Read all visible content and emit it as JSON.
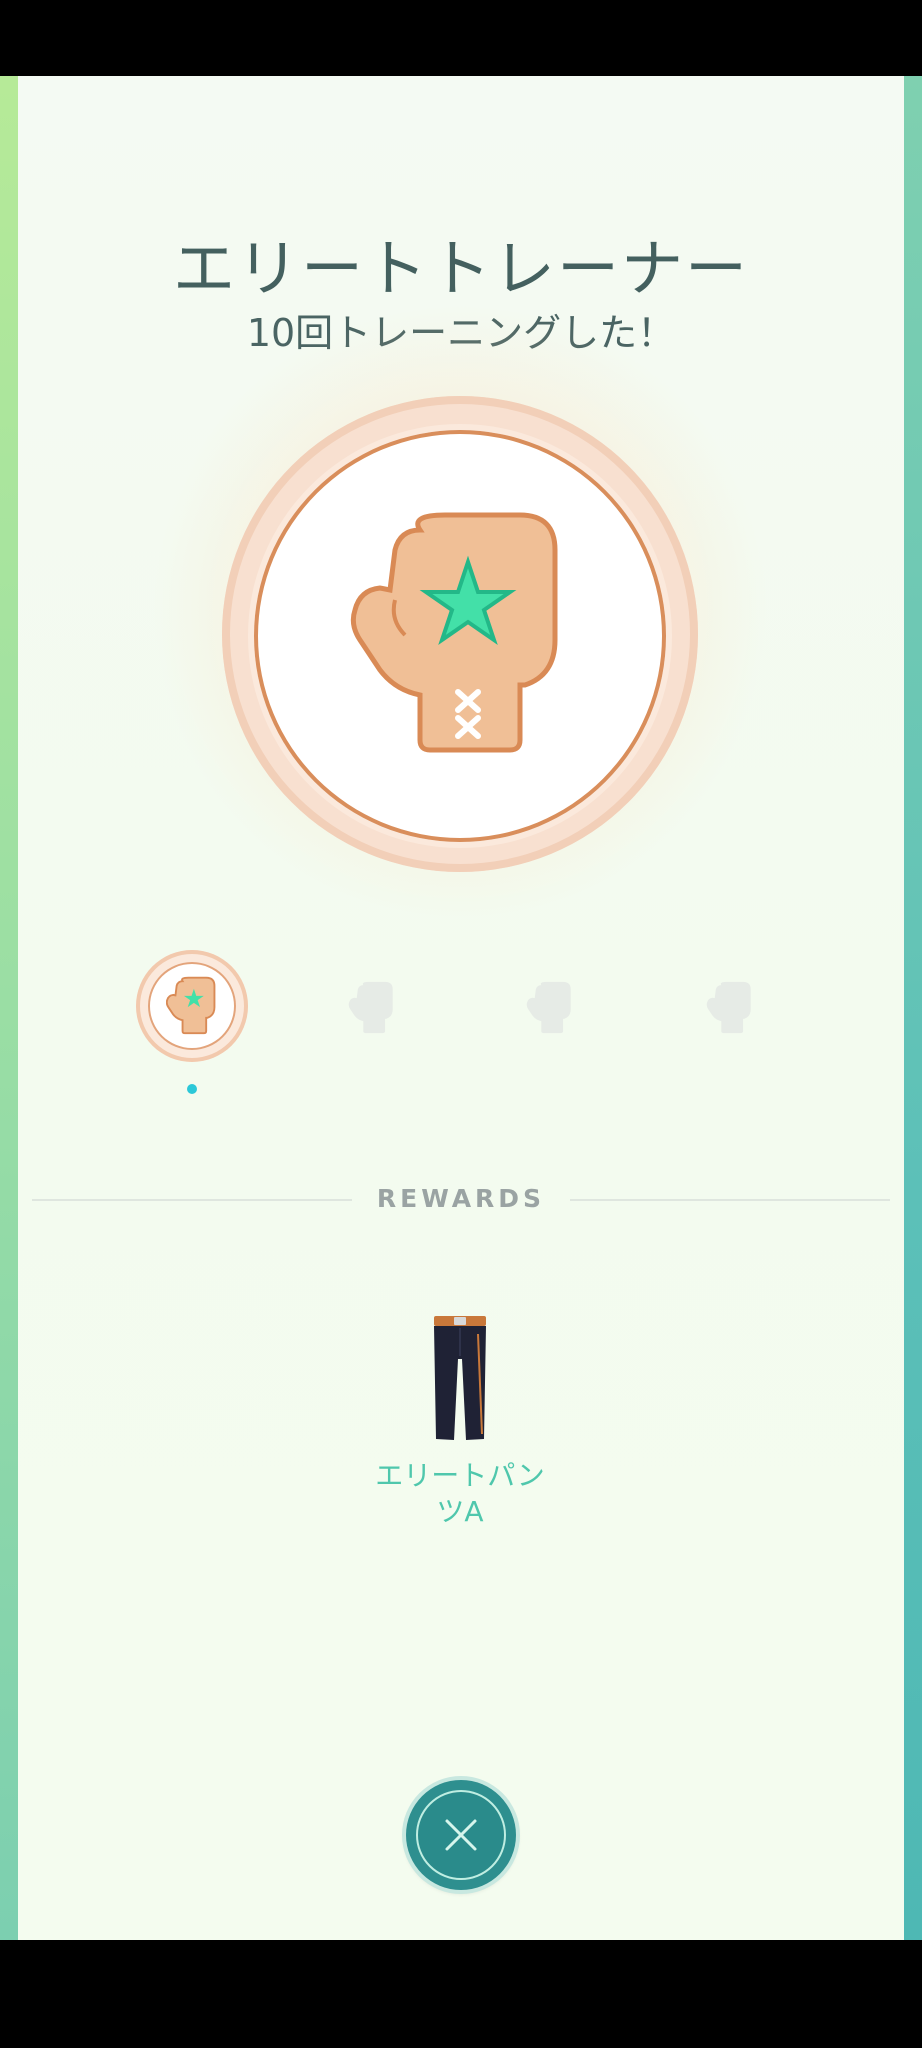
{
  "medal": {
    "title": "エリートトレーナー",
    "description": "10回トレーニングした！",
    "icon": "boxing-glove-star-icon",
    "tier_color": "#f0c09a",
    "star_color": "#3ee0a8"
  },
  "tiers": {
    "count": 4,
    "selected_index": 0,
    "unlocked": [
      true,
      false,
      false,
      false
    ]
  },
  "rewards": {
    "header": "REWARDS",
    "items": [
      {
        "name": "エリートパン\nツA",
        "icon": "pants-icon"
      }
    ]
  },
  "close_button": {
    "icon": "close-icon",
    "color": "#2e8f8f"
  }
}
